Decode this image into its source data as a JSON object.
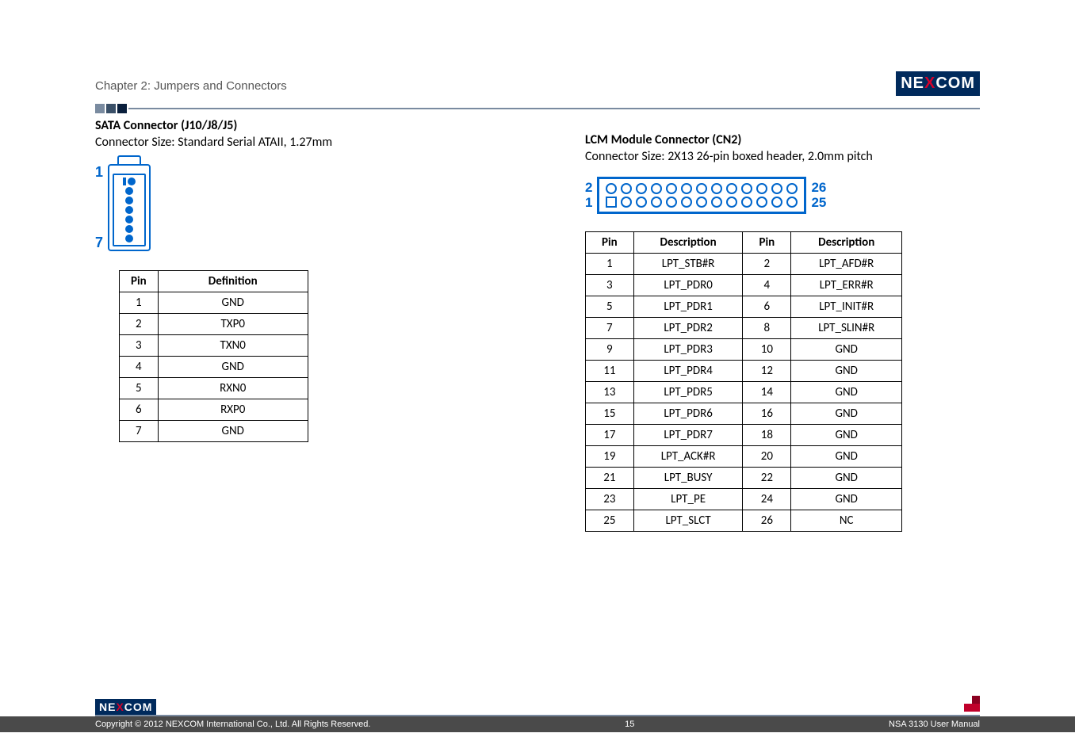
{
  "header": {
    "chapter": "Chapter 2: Jumpers and Connectors",
    "brand_ne": "NE",
    "brand_x": "X",
    "brand_com": "COM"
  },
  "left": {
    "title": "SATA Connector (J10/J8/J5)",
    "subtitle": "Connector Size: Standard Serial ATAII, 1.27mm",
    "diagram_top": "1",
    "diagram_bottom": "7",
    "table": {
      "head_pin": "Pin",
      "head_def": "Definition",
      "rows": [
        {
          "pin": "1",
          "def": "GND"
        },
        {
          "pin": "2",
          "def": "TXP0"
        },
        {
          "pin": "3",
          "def": "TXN0"
        },
        {
          "pin": "4",
          "def": "GND"
        },
        {
          "pin": "5",
          "def": "RXN0"
        },
        {
          "pin": "6",
          "def": "RXP0"
        },
        {
          "pin": "7",
          "def": "GND"
        }
      ]
    }
  },
  "right": {
    "title": "LCM Module Connector (CN2)",
    "subtitle": "Connector Size: 2X13 26-pin boxed header, 2.0mm pitch",
    "diagram_left_top": "2",
    "diagram_left_bottom": "1",
    "diagram_right_top": "26",
    "diagram_right_bottom": "25",
    "table": {
      "head_pin": "Pin",
      "head_desc": "Description",
      "rows": [
        {
          "p1": "1",
          "d1": "LPT_STB#R",
          "p2": "2",
          "d2": "LPT_AFD#R"
        },
        {
          "p1": "3",
          "d1": "LPT_PDR0",
          "p2": "4",
          "d2": "LPT_ERR#R"
        },
        {
          "p1": "5",
          "d1": "LPT_PDR1",
          "p2": "6",
          "d2": "LPT_INIT#R"
        },
        {
          "p1": "7",
          "d1": "LPT_PDR2",
          "p2": "8",
          "d2": "LPT_SLIN#R"
        },
        {
          "p1": "9",
          "d1": "LPT_PDR3",
          "p2": "10",
          "d2": "GND"
        },
        {
          "p1": "11",
          "d1": "LPT_PDR4",
          "p2": "12",
          "d2": "GND"
        },
        {
          "p1": "13",
          "d1": "LPT_PDR5",
          "p2": "14",
          "d2": "GND"
        },
        {
          "p1": "15",
          "d1": "LPT_PDR6",
          "p2": "16",
          "d2": "GND"
        },
        {
          "p1": "17",
          "d1": "LPT_PDR7",
          "p2": "18",
          "d2": "GND"
        },
        {
          "p1": "19",
          "d1": "LPT_ACK#R",
          "p2": "20",
          "d2": "GND"
        },
        {
          "p1": "21",
          "d1": "LPT_BUSY",
          "p2": "22",
          "d2": "GND"
        },
        {
          "p1": "23",
          "d1": "LPT_PE",
          "p2": "24",
          "d2": "GND"
        },
        {
          "p1": "25",
          "d1": "LPT_SLCT",
          "p2": "26",
          "d2": "NC"
        }
      ]
    }
  },
  "footer": {
    "copyright": "Copyright © 2012 NEXCOM International Co., Ltd. All Rights Reserved.",
    "page_num": "15",
    "doc": "NSA 3130 User Manual"
  }
}
